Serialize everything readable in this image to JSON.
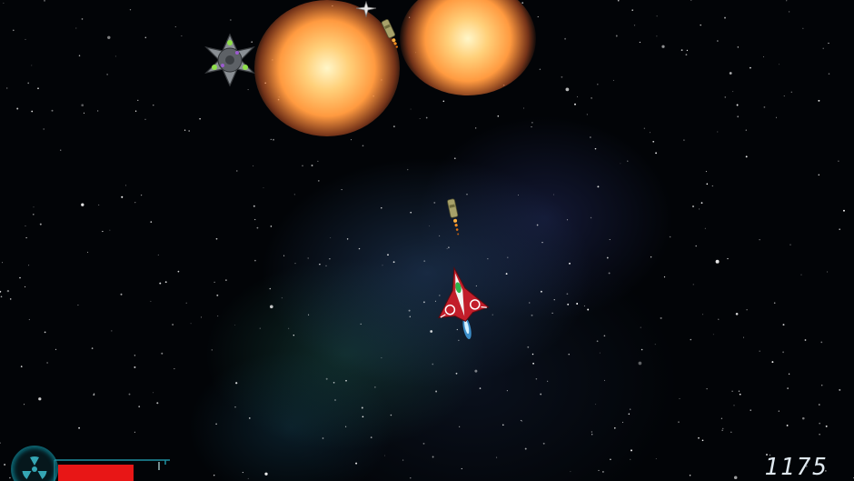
{
  "hud": {
    "score": "1175",
    "health_fraction": 0.8,
    "health_color": "#e81616",
    "special_icon": "radiation-icon"
  },
  "entities": {
    "player": "red-white-starfighter",
    "enemy": "grey-spiked-mine-with-green-lights",
    "missiles": [
      "homing-missile",
      "homing-missile"
    ],
    "explosions": 2
  },
  "colors": {
    "space": "#020407",
    "nebula": "#284670",
    "explosion_core": "#fff6c8",
    "explosion_outer": "#ff9a40"
  }
}
